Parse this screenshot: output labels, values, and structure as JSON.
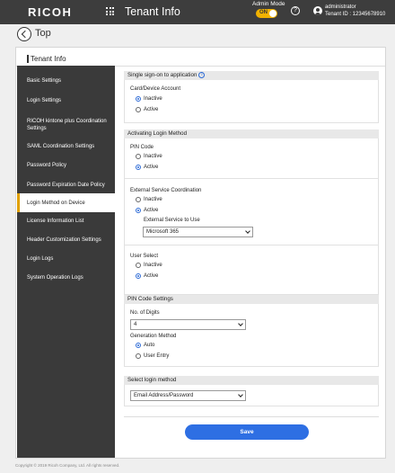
{
  "header": {
    "logo": "RICOH",
    "app_title": "Tenant Info",
    "admin_mode_label": "Admin Mode",
    "admin_mode_toggle": "ON",
    "help_symbol": "?",
    "user_name": "administrator",
    "tenant_id": "Tenant ID : 12345678910"
  },
  "back": {
    "label": "Top"
  },
  "page": {
    "title": "Tenant Info"
  },
  "sidebar": {
    "items": [
      {
        "label": "Basic Settings"
      },
      {
        "label": "Login Settings"
      },
      {
        "label": "RICOH kintone plus Coordination Settings"
      },
      {
        "label": "SAML Coordination Settings"
      },
      {
        "label": "Password Policy"
      },
      {
        "label": "Password Expiration Date Policy"
      },
      {
        "label": "Login Method on Device",
        "active": true
      },
      {
        "label": "License Information List"
      },
      {
        "label": "Header Customization Settings"
      },
      {
        "label": "Login Logs"
      },
      {
        "label": "System Operation Logs"
      }
    ]
  },
  "sso": {
    "heading": "Single sign-on to application",
    "info_symbol": "i",
    "card_device_label": "Card/Device Account",
    "inactive": "Inactive",
    "active": "Active",
    "selected": "Inactive"
  },
  "login_method": {
    "heading": "Activating Login Method",
    "pin_label": "PIN Code",
    "pin_inactive": "Inactive",
    "pin_active": "Active",
    "pin_selected": "Active",
    "ext_label": "External Service Coordination",
    "ext_inactive": "Inactive",
    "ext_active": "Active",
    "ext_selected": "Active",
    "ext_service_label": "External Service to Use",
    "ext_service_value": "Microsoft 365",
    "user_select_label": "User Select",
    "us_inactive": "Inactive",
    "us_active": "Active",
    "us_selected": "Active"
  },
  "pin_settings": {
    "heading": "PIN Code Settings",
    "digits_label": "No. of Digits",
    "digits_value": "4",
    "gen_label": "Generation Method",
    "gen_auto": "Auto",
    "gen_user": "User Entry",
    "gen_selected": "Auto"
  },
  "select_login": {
    "heading": "Select login method",
    "value": "Email Address/Password"
  },
  "actions": {
    "save": "Save"
  },
  "footer": {
    "copyright": "Copyright © 2019 Ricoh Company, Ltd. All rights reserved."
  },
  "colors": {
    "header_bg": "#3d3d3d",
    "sidebar_bg": "#3a3a3a",
    "accent": "#2e6fe3",
    "toggle": "#f2b200",
    "active_marker": "#e0a000"
  },
  "icons": [
    "apps-grid-icon",
    "help-icon",
    "user-icon",
    "back-arrow-icon",
    "info-icon",
    "chevron-down-icon"
  ]
}
